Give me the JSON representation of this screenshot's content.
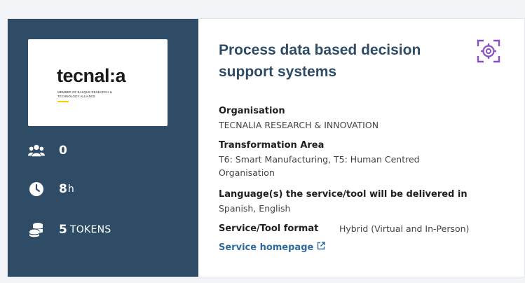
{
  "card": {
    "logo": {
      "wordmark_start": "tecnal",
      "wordmark_colon": ":",
      "wordmark_end": "a",
      "tagline": "MEMBER OF BASQUE RESEARCH & TECHNOLOGY ALLIANCE"
    },
    "stats": {
      "participants": {
        "icon": "users-icon",
        "value": "0"
      },
      "duration": {
        "icon": "clock-icon",
        "value": "8",
        "unit": "h"
      },
      "tokens": {
        "icon": "coins-icon",
        "value": "5",
        "unit": "TOKENS"
      }
    },
    "title": "Process data based decision support systems",
    "corner_icon": "settings-scan-icon",
    "organisation": {
      "label": "Organisation",
      "value": "TECNALIA RESEARCH & INNOVATION"
    },
    "transformation_area": {
      "label": "Transformation Area",
      "value": "T6: Smart Manufacturing, T5: Human Centred Organisation"
    },
    "language": {
      "label": "Language(s) the service/tool will be delivered in",
      "value": "Spanish, English"
    },
    "format": {
      "label": "Service/Tool format",
      "value": "Hybrid (Virtual and In-Person)"
    },
    "homepage_link": "Service homepage"
  },
  "colors": {
    "sidebar": "#2f4c67",
    "title": "#2f4c67",
    "accent_icon": "#8a4fc7",
    "link": "#2f6a9e",
    "logo_accent": "#f3d200"
  }
}
